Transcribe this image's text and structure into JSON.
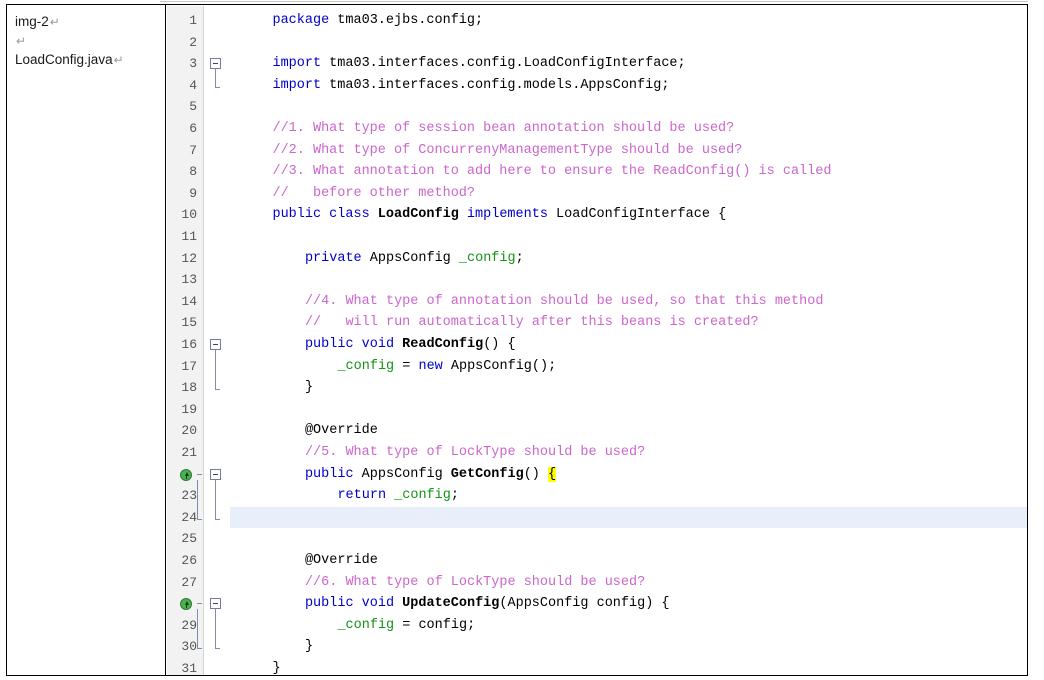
{
  "document": {
    "caption_cell": {
      "lines": [
        {
          "text": "img-2",
          "pilcrow": "↵"
        },
        {
          "text": "",
          "pilcrow": "↵"
        },
        {
          "text": "LoadConfig.java",
          "pilcrow": "↵"
        }
      ]
    },
    "tail_pilcrow": "↵"
  },
  "editor": {
    "file_name": "LoadConfig.java",
    "colors": {
      "keyword": "#0000cc",
      "comment": "#cc66cc",
      "field": "#149414",
      "class_name": "#000000",
      "plain_text": "#000000",
      "brace_match_highlight": "#ffff00",
      "caret_line": "#e8eefa",
      "gutter_background": "#f2f2f2",
      "editor_background": "#ffffff",
      "override_marker": "#4caf50"
    },
    "caret_line_number": 24,
    "lines": [
      {
        "n": "1",
        "indent": 4,
        "tokens": [
          {
            "t": "package",
            "c": "kw"
          },
          {
            "t": " tma03.ejbs.config;",
            "c": "plain"
          }
        ]
      },
      {
        "n": "2",
        "indent": 4,
        "tokens": []
      },
      {
        "n": "3",
        "indent": 4,
        "fold": "start",
        "tokens": [
          {
            "t": "import",
            "c": "kw"
          },
          {
            "t": " tma03.interfaces.config.LoadConfigInterface;",
            "c": "plain"
          }
        ]
      },
      {
        "n": "4",
        "indent": 4,
        "fold": "end",
        "tokens": [
          {
            "t": "import",
            "c": "kw"
          },
          {
            "t": " tma03.interfaces.config.models.AppsConfig;",
            "c": "plain"
          }
        ]
      },
      {
        "n": "5",
        "indent": 4,
        "tokens": []
      },
      {
        "n": "6",
        "indent": 4,
        "tokens": [
          {
            "t": "//1. What type of session bean annotation should be used?",
            "c": "cmt"
          }
        ]
      },
      {
        "n": "7",
        "indent": 4,
        "tokens": [
          {
            "t": "//2. What type of ConcurrenyManagementType should be used?",
            "c": "cmt"
          }
        ]
      },
      {
        "n": "8",
        "indent": 4,
        "tokens": [
          {
            "t": "//3. What annotation to add here to ensure the ReadConfig() is called",
            "c": "cmt"
          }
        ]
      },
      {
        "n": "9",
        "indent": 4,
        "tokens": [
          {
            "t": "//   before other method?",
            "c": "cmt"
          }
        ]
      },
      {
        "n": "10",
        "indent": 4,
        "tokens": [
          {
            "t": "public class ",
            "c": "kw"
          },
          {
            "t": "LoadConfig",
            "c": "cls"
          },
          {
            "t": " ",
            "c": "plain"
          },
          {
            "t": "implements",
            "c": "kw"
          },
          {
            "t": " LoadConfigInterface {",
            "c": "plain"
          }
        ]
      },
      {
        "n": "11",
        "indent": 4,
        "tokens": []
      },
      {
        "n": "12",
        "indent": 8,
        "tokens": [
          {
            "t": "private",
            "c": "kw"
          },
          {
            "t": " AppsConfig ",
            "c": "plain"
          },
          {
            "t": "_config",
            "c": "fld"
          },
          {
            "t": ";",
            "c": "plain"
          }
        ]
      },
      {
        "n": "13",
        "indent": 8,
        "tokens": []
      },
      {
        "n": "14",
        "indent": 8,
        "tokens": [
          {
            "t": "//4. What type of annotation should be used, so that this method",
            "c": "cmt"
          }
        ]
      },
      {
        "n": "15",
        "indent": 8,
        "tokens": [
          {
            "t": "//   will run automatically after this beans is created?",
            "c": "cmt"
          }
        ]
      },
      {
        "n": "16",
        "indent": 8,
        "fold": "start",
        "tokens": [
          {
            "t": "public void ",
            "c": "kw"
          },
          {
            "t": "ReadConfig",
            "c": "cls"
          },
          {
            "t": "() {",
            "c": "plain"
          }
        ]
      },
      {
        "n": "17",
        "indent": 12,
        "tokens": [
          {
            "t": "_config",
            "c": "fld"
          },
          {
            "t": " = ",
            "c": "plain"
          },
          {
            "t": "new",
            "c": "kw"
          },
          {
            "t": " AppsConfig();",
            "c": "plain"
          }
        ]
      },
      {
        "n": "18",
        "indent": 8,
        "fold": "end",
        "tokens": [
          {
            "t": "}",
            "c": "plain"
          }
        ]
      },
      {
        "n": "19",
        "indent": 8,
        "tokens": []
      },
      {
        "n": "20",
        "indent": 8,
        "tokens": [
          {
            "t": "@Override",
            "c": "plain"
          }
        ]
      },
      {
        "n": "21",
        "indent": 8,
        "tokens": [
          {
            "t": "//5. What type of LockType should be used?",
            "c": "cmt"
          }
        ]
      },
      {
        "n": "22",
        "indent": 8,
        "fold": "start",
        "override": true,
        "tokens": [
          {
            "t": "public",
            "c": "kw"
          },
          {
            "t": " AppsConfig ",
            "c": "plain"
          },
          {
            "t": "GetConfig",
            "c": "cls"
          },
          {
            "t": "() ",
            "c": "plain"
          },
          {
            "t": "{",
            "c": "plain",
            "hl": true
          }
        ]
      },
      {
        "n": "23",
        "indent": 12,
        "tokens": [
          {
            "t": "return",
            "c": "kw"
          },
          {
            "t": " ",
            "c": "plain"
          },
          {
            "t": "_config",
            "c": "fld"
          },
          {
            "t": ";",
            "c": "plain"
          }
        ]
      },
      {
        "n": "24",
        "indent": 8,
        "fold": "end",
        "tokens": [
          {
            "t": "}",
            "c": "plain",
            "hl": true
          }
        ]
      },
      {
        "n": "25",
        "indent": 8,
        "tokens": []
      },
      {
        "n": "26",
        "indent": 8,
        "tokens": [
          {
            "t": "@Override",
            "c": "plain"
          }
        ]
      },
      {
        "n": "27",
        "indent": 8,
        "tokens": [
          {
            "t": "//6. What type of LockType should be used?",
            "c": "cmt"
          }
        ]
      },
      {
        "n": "28",
        "indent": 8,
        "fold": "start",
        "override": true,
        "tokens": [
          {
            "t": "public void ",
            "c": "kw"
          },
          {
            "t": "UpdateConfig",
            "c": "cls"
          },
          {
            "t": "(AppsConfig config) {",
            "c": "plain"
          }
        ]
      },
      {
        "n": "29",
        "indent": 12,
        "tokens": [
          {
            "t": "_config",
            "c": "fld"
          },
          {
            "t": " = config;",
            "c": "plain"
          }
        ]
      },
      {
        "n": "30",
        "indent": 8,
        "fold": "end",
        "tokens": [
          {
            "t": "}",
            "c": "plain"
          }
        ]
      },
      {
        "n": "31",
        "indent": 4,
        "tokens": [
          {
            "t": "}",
            "c": "plain"
          }
        ]
      }
    ]
  }
}
